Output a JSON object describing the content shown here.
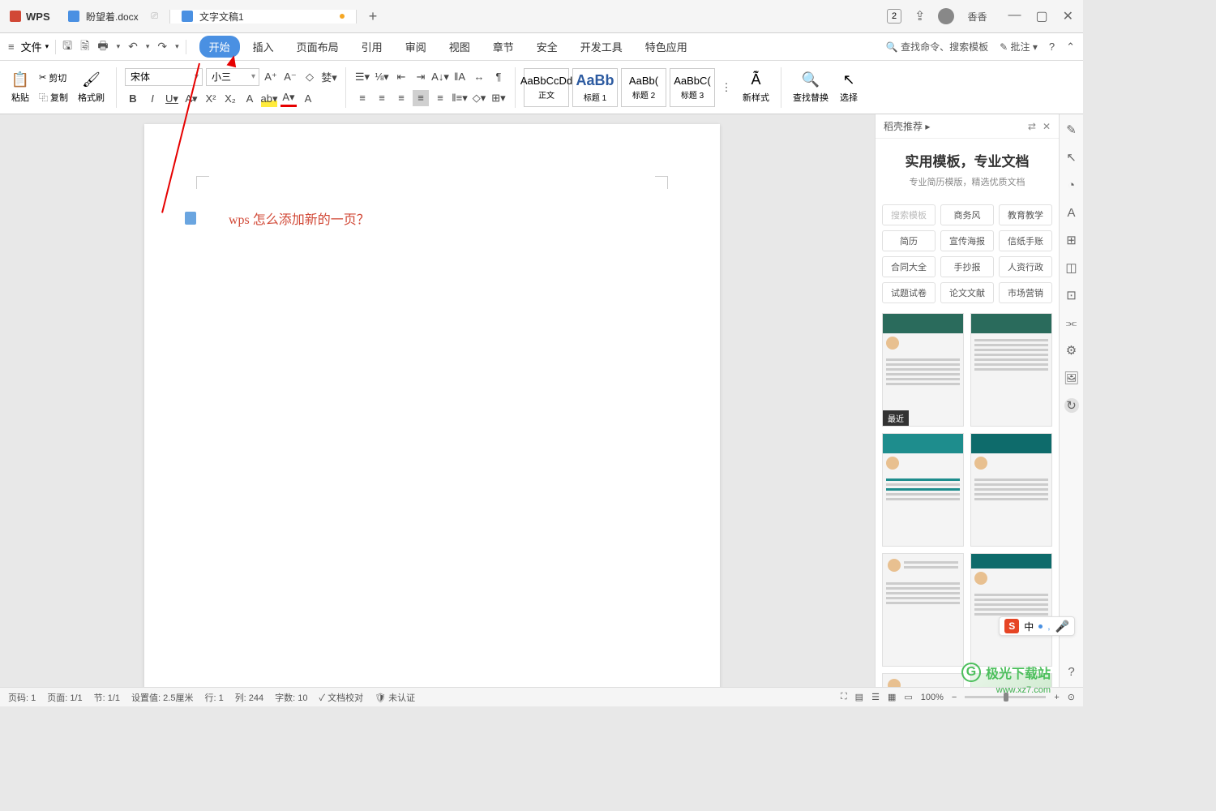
{
  "titlebar": {
    "app": "WPS",
    "tabs": [
      {
        "label": "盼望着.docx",
        "active": false
      },
      {
        "label": "文字文稿1",
        "active": true,
        "unsaved": true
      }
    ],
    "user": "香香",
    "badge": "2"
  },
  "menubar": {
    "file": "文件",
    "tabs": [
      "开始",
      "插入",
      "页面布局",
      "引用",
      "审阅",
      "视图",
      "章节",
      "安全",
      "开发工具",
      "特色应用"
    ],
    "active_tab": 0,
    "search": "查找命令、搜索模板",
    "comment": "批注"
  },
  "ribbon": {
    "paste": "粘贴",
    "cut": "剪切",
    "copy": "复制",
    "format_painter": "格式刷",
    "font": "宋体",
    "size": "小三",
    "styles": [
      {
        "preview": "AaBbCcDd",
        "name": "正文"
      },
      {
        "preview": "AaBb",
        "name": "标题 1"
      },
      {
        "preview": "AaBb(",
        "name": "标题 2"
      },
      {
        "preview": "AaBbC(",
        "name": "标题 3"
      }
    ],
    "new_style": "新样式",
    "find_replace": "查找替换",
    "select": "选择"
  },
  "document": {
    "text": "wps 怎么添加新的一页？"
  },
  "panel": {
    "header": "稻壳推荐",
    "promo_title": "实用模板，专业文档",
    "promo_sub": "专业简历模版，精选优质文档",
    "search_placeholder": "搜索模板",
    "categories_row1": [
      "搜索模板",
      "商务风",
      "教育教学"
    ],
    "categories_row2": [
      "简历",
      "宣传海报",
      "信纸手账"
    ],
    "categories_row3": [
      "合同大全",
      "手抄报",
      "人资行政"
    ],
    "categories_row4": [
      "试题试卷",
      "论文文献",
      "市场营销"
    ],
    "recent_badge": "最近"
  },
  "statusbar": {
    "page_no": "页码: 1",
    "page_count": "页面: 1/1",
    "section": "节: 1/1",
    "position": "设置值: 2.5厘米",
    "line": "行: 1",
    "column": "列: 244",
    "word_count": "字数: 10",
    "proof": "文档校对",
    "auth": "未认证",
    "zoom": "100%"
  },
  "ime": {
    "zh": "中"
  },
  "watermark": {
    "name": "极光下载站",
    "url": "www.xz7.com"
  }
}
